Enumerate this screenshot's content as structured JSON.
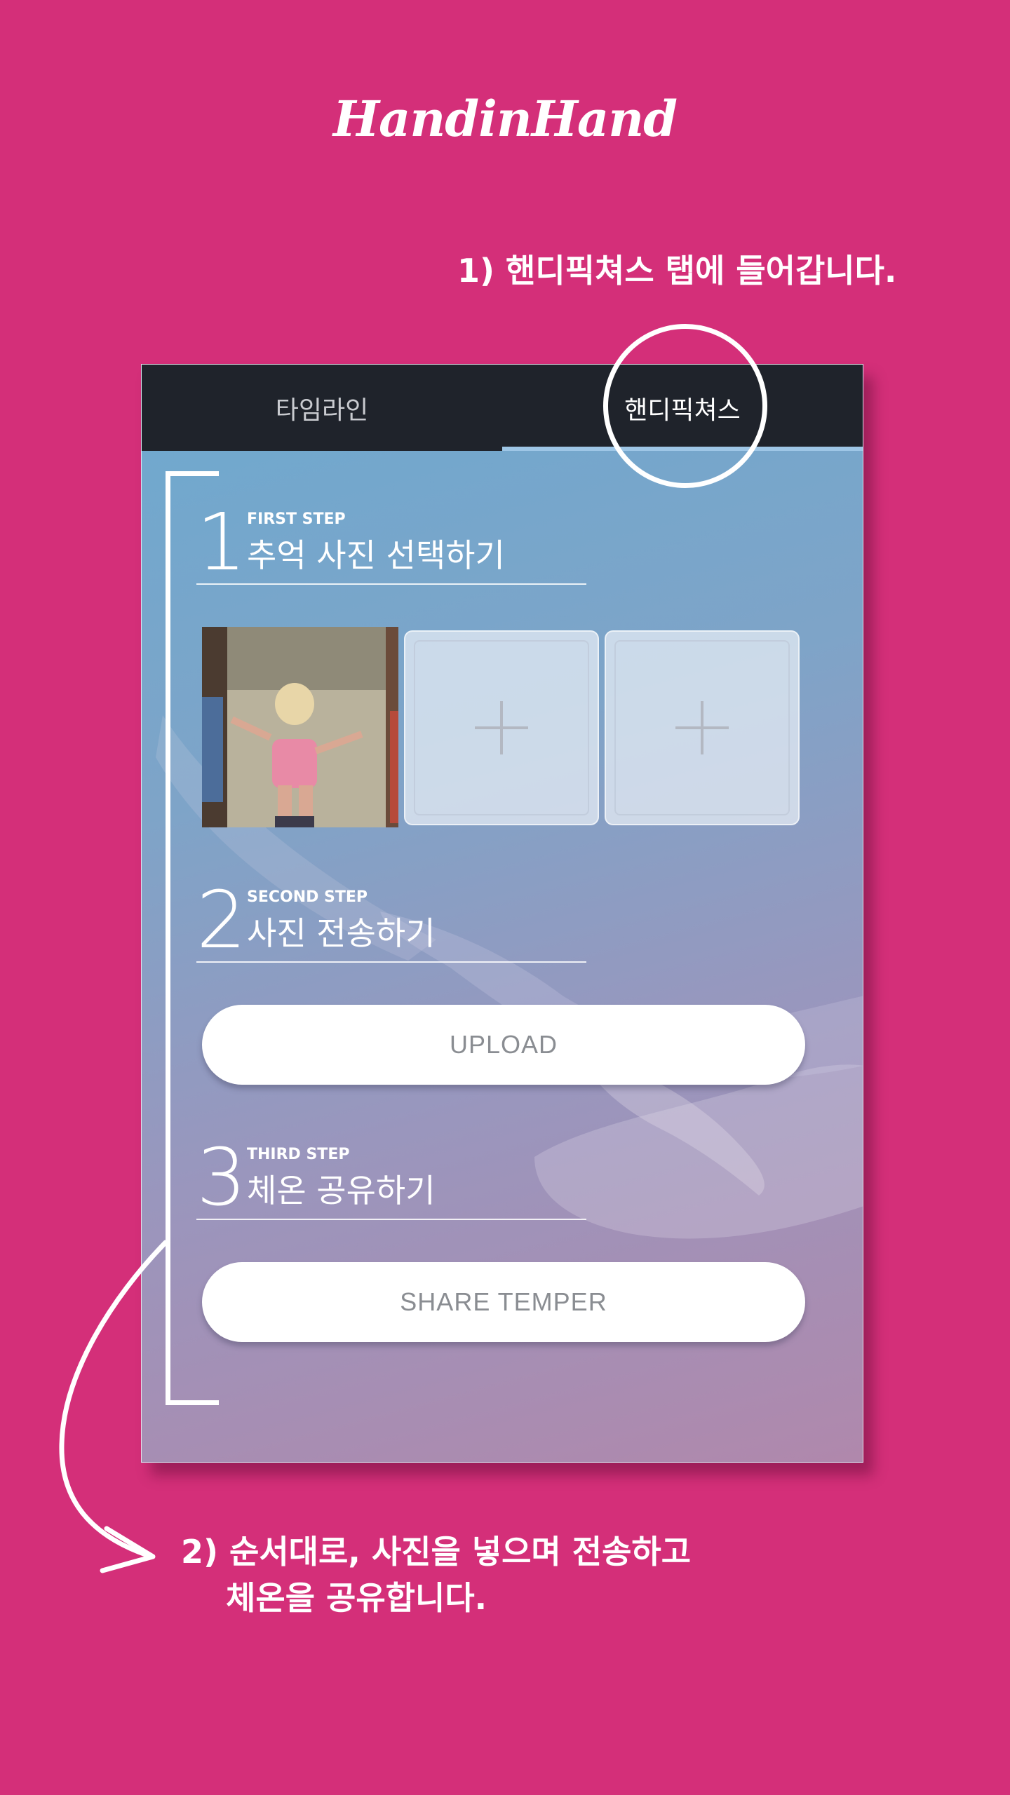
{
  "logo": "HandinHand",
  "caption1": "1) 핸디픽쳐스 탭에 들어갑니다.",
  "caption2": "2) 순서대로, 사진을 넣으며 전송하고\n    체온을 공유합니다.",
  "tabs": [
    {
      "label": "타임라인",
      "active": false
    },
    {
      "label": "핸디픽쳐스",
      "active": true
    }
  ],
  "steps": [
    {
      "number": "1",
      "sub": "FIRST STEP",
      "title": "추억 사진 선택하기"
    },
    {
      "number": "2",
      "sub": "SECOND STEP",
      "title": "사진 전송하기"
    },
    {
      "number": "3",
      "sub": "THIRD STEP",
      "title": "체온 공유하기"
    }
  ],
  "buttons": {
    "upload": "UPLOAD",
    "share": "SHARE TEMPER"
  },
  "colors": {
    "background": "#d42f79",
    "tabbar": "#1f232b",
    "tab_indicator": "#9ec6e6"
  }
}
